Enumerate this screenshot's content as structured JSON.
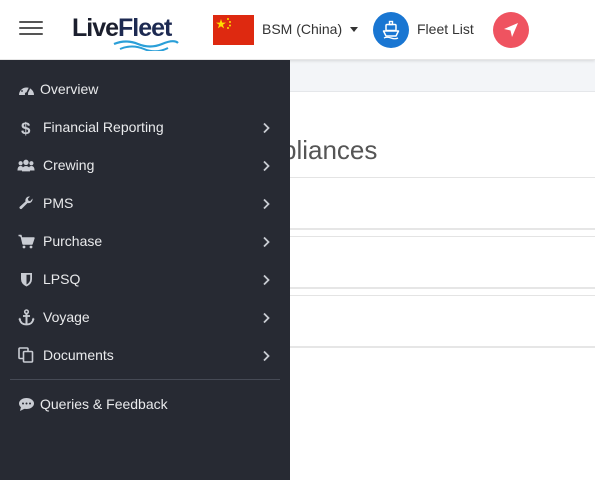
{
  "header": {
    "logo": {
      "text_live": "Live",
      "text_fleet": "Fleet"
    },
    "company": {
      "label": "BSM (China)"
    },
    "fleet_list": {
      "label": "Fleet List"
    },
    "colors": {
      "ship_button": "#1976d2",
      "nav_button": "#ef5360",
      "flag_red": "#de2910",
      "flag_star": "#ffde00"
    }
  },
  "main": {
    "title_partial": "pliances"
  },
  "sidebar": {
    "items": [
      {
        "label": "Overview",
        "icon": "dashboard-icon",
        "has_submenu": false
      },
      {
        "label": "Financial Reporting",
        "icon": "dollar-icon",
        "has_submenu": true
      },
      {
        "label": "Crewing",
        "icon": "users-icon",
        "has_submenu": true
      },
      {
        "label": "PMS",
        "icon": "wrench-icon",
        "has_submenu": true
      },
      {
        "label": "Purchase",
        "icon": "cart-icon",
        "has_submenu": true
      },
      {
        "label": "LPSQ",
        "icon": "shield-icon",
        "has_submenu": true
      },
      {
        "label": "Voyage",
        "icon": "anchor-icon",
        "has_submenu": true
      },
      {
        "label": "Documents",
        "icon": "documents-icon",
        "has_submenu": true
      }
    ],
    "footer_item": {
      "label": "Queries & Feedback",
      "icon": "comments-icon"
    },
    "colors": {
      "background": "#272a33",
      "text": "#e9eaec",
      "icon": "#c9ccd3"
    }
  }
}
